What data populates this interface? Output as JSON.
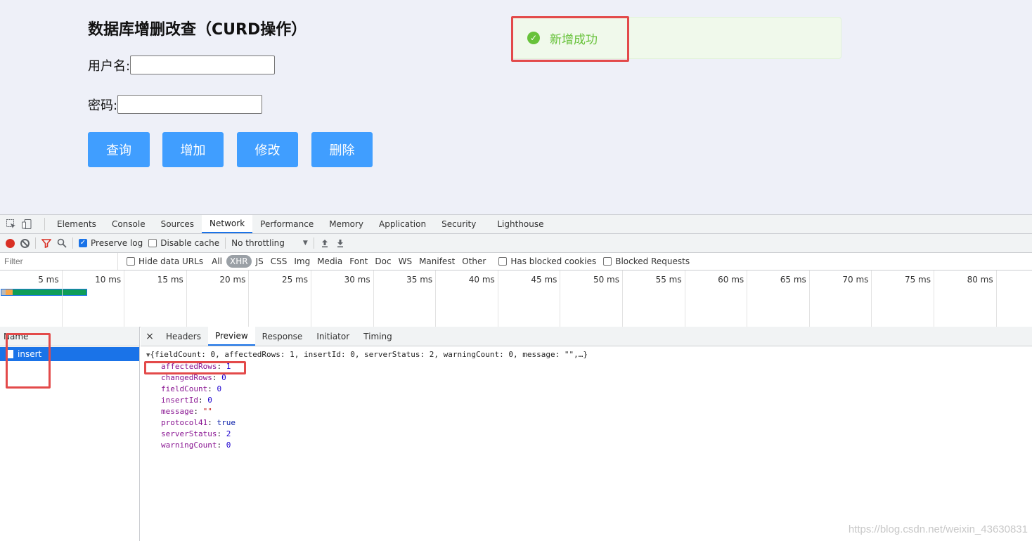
{
  "app": {
    "title": "数据库增删改查（CURD操作）",
    "username_label": "用户名:",
    "username_value": "",
    "password_label": "密码:",
    "password_value": "",
    "buttons": {
      "query": "查询",
      "add": "增加",
      "edit": "修改",
      "delete": "删除"
    },
    "toast": {
      "icon": "check-circle-icon",
      "text": "新增成功"
    }
  },
  "colors": {
    "primary": "#409eff",
    "success": "#67c23a",
    "annotation": "#e34a4a",
    "devtools_accent": "#1a73e8"
  },
  "devtools": {
    "tabs": [
      "Elements",
      "Console",
      "Sources",
      "Network",
      "Performance",
      "Memory",
      "Application",
      "Security",
      "Lighthouse"
    ],
    "active_tab": "Network",
    "toolbar": {
      "preserve_log": "Preserve log",
      "preserve_log_checked": true,
      "disable_cache": "Disable cache",
      "disable_cache_checked": false,
      "throttling": "No throttling"
    },
    "filter": {
      "placeholder": "Filter",
      "hide_data_urls": "Hide data URLs",
      "types": [
        "All",
        "XHR",
        "JS",
        "CSS",
        "Img",
        "Media",
        "Font",
        "Doc",
        "WS",
        "Manifest",
        "Other"
      ],
      "active_type": "XHR",
      "has_blocked_cookies": "Has blocked cookies",
      "blocked_requests": "Blocked Requests"
    },
    "timeline_ticks": [
      "5 ms",
      "10 ms",
      "15 ms",
      "20 ms",
      "25 ms",
      "30 ms",
      "35 ms",
      "40 ms",
      "45 ms",
      "50 ms",
      "55 ms",
      "60 ms",
      "65 ms",
      "70 ms",
      "75 ms",
      "80 ms"
    ],
    "requests": {
      "header": "Name",
      "items": [
        {
          "name": "insert"
        }
      ]
    },
    "detail_tabs": [
      "Headers",
      "Preview",
      "Response",
      "Initiator",
      "Timing"
    ],
    "active_detail_tab": "Preview",
    "preview": {
      "summary": "{fieldCount: 0, affectedRows: 1, insertId: 0, serverStatus: 2, warningCount: 0, message: \"\",…}",
      "props": [
        {
          "key": "affectedRows",
          "value": "1",
          "kind": "num"
        },
        {
          "key": "changedRows",
          "value": "0",
          "kind": "num"
        },
        {
          "key": "fieldCount",
          "value": "0",
          "kind": "num"
        },
        {
          "key": "insertId",
          "value": "0",
          "kind": "num"
        },
        {
          "key": "message",
          "value": "\"\"",
          "kind": "str"
        },
        {
          "key": "protocol41",
          "value": "true",
          "kind": "bool"
        },
        {
          "key": "serverStatus",
          "value": "2",
          "kind": "num"
        },
        {
          "key": "warningCount",
          "value": "0",
          "kind": "num"
        }
      ]
    }
  },
  "watermark": "https://blog.csdn.net/weixin_43630831"
}
